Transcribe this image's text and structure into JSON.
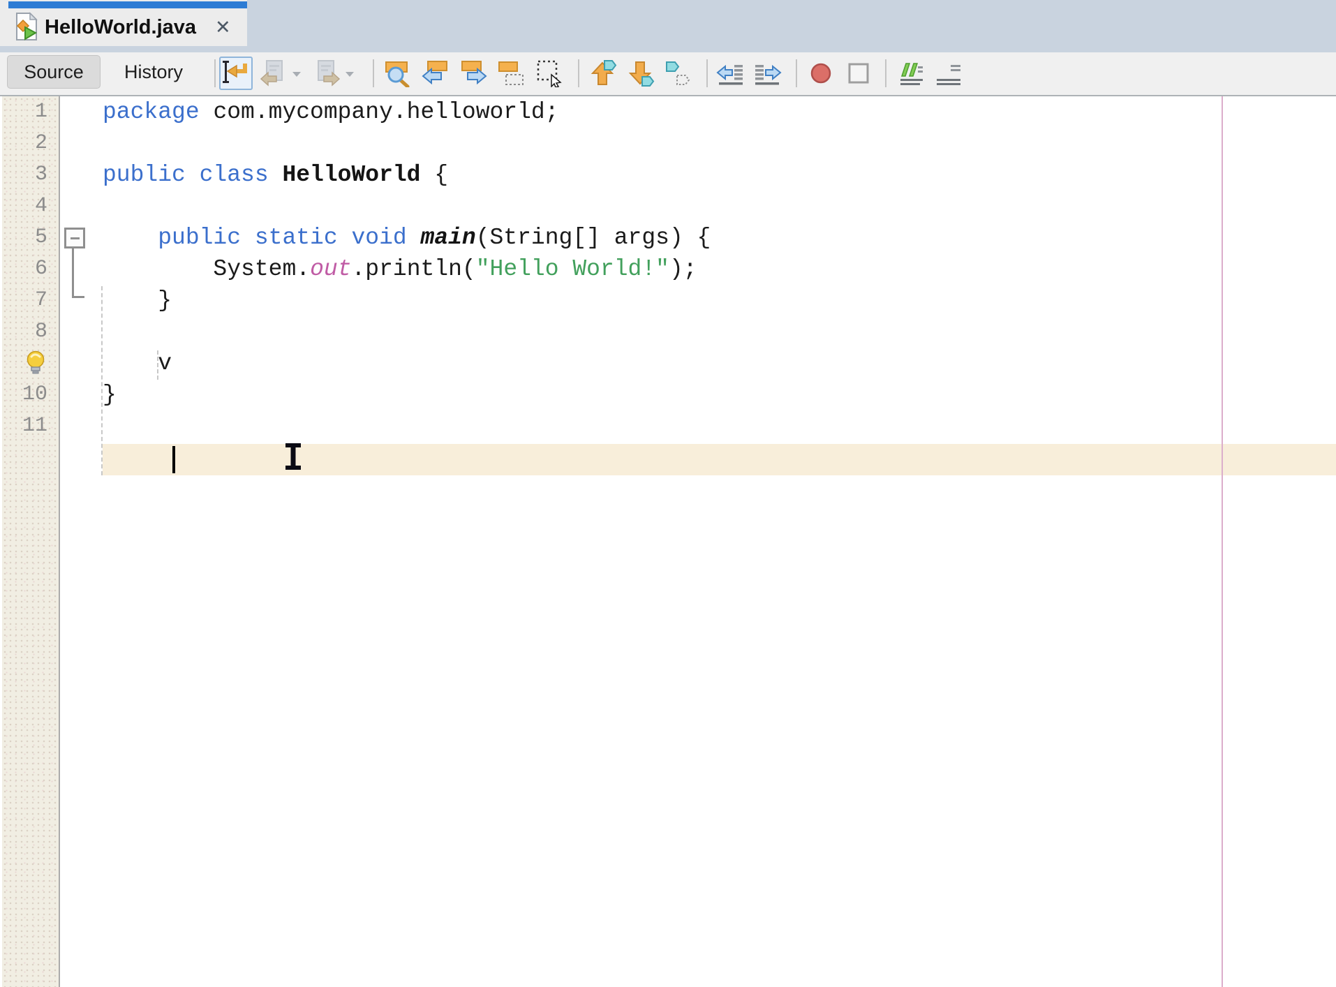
{
  "tab": {
    "title": "HelloWorld.java",
    "close_glyph": "✕",
    "icon": "java-file-icon"
  },
  "toolbar": {
    "source_label": "Source",
    "history_label": "History",
    "icons": [
      "jump-last-edit-icon",
      "back-icon",
      "back-dropdown-icon",
      "forward-icon",
      "forward-dropdown-icon",
      "find-selection-icon",
      "find-previous-icon",
      "find-next-icon",
      "toggle-highlight-search-icon",
      "rectangular-selection-icon",
      "previous-bookmark-icon",
      "next-bookmark-icon",
      "toggle-bookmark-icon",
      "shift-line-left-icon",
      "shift-line-right-icon",
      "start-macro-recording-icon",
      "stop-macro-recording-icon",
      "comment-icon",
      "uncomment-icon"
    ]
  },
  "editor": {
    "current_line": 9,
    "hint_bulb_line": 9,
    "right_margin_color": "#DCAECB",
    "highlight_color": "#F8EEDA",
    "syntax_colors": {
      "keyword": "#3B6FCC",
      "plain": "#1B1B1B",
      "static_field": "#C05CA5",
      "string": "#42A05C"
    },
    "lines": [
      {
        "num": "1",
        "tokens": [
          {
            "t": "package ",
            "c": "kw"
          },
          {
            "t": "com.mycompany.helloworld;",
            "c": "pl"
          }
        ]
      },
      {
        "num": "2",
        "tokens": []
      },
      {
        "num": "3",
        "tokens": [
          {
            "t": "public class ",
            "c": "kw"
          },
          {
            "t": "HelloWorld",
            "c": "cls"
          },
          {
            "t": " {",
            "c": "pl"
          }
        ]
      },
      {
        "num": "4",
        "tokens": []
      },
      {
        "num": "5",
        "tokens": [
          {
            "t": "    ",
            "c": "pl"
          },
          {
            "t": "public static void ",
            "c": "kw"
          },
          {
            "t": "main",
            "c": "mth"
          },
          {
            "t": "(String[] args) {",
            "c": "pl"
          }
        ]
      },
      {
        "num": "6",
        "tokens": [
          {
            "t": "        System.",
            "c": "pl"
          },
          {
            "t": "out",
            "c": "fld"
          },
          {
            "t": ".println(",
            "c": "pl"
          },
          {
            "t": "\"Hello World!\"",
            "c": "str"
          },
          {
            "t": ");",
            "c": "pl"
          }
        ]
      },
      {
        "num": "7",
        "tokens": [
          {
            "t": "    }",
            "c": "pl"
          }
        ]
      },
      {
        "num": "8",
        "tokens": []
      },
      {
        "num": "",
        "bulb": true,
        "highlight": true,
        "tokens": [
          {
            "t": "    v",
            "c": "pl"
          }
        ]
      },
      {
        "num": "10",
        "tokens": [
          {
            "t": "}",
            "c": "pl"
          }
        ]
      },
      {
        "num": "11",
        "tokens": []
      }
    ]
  }
}
